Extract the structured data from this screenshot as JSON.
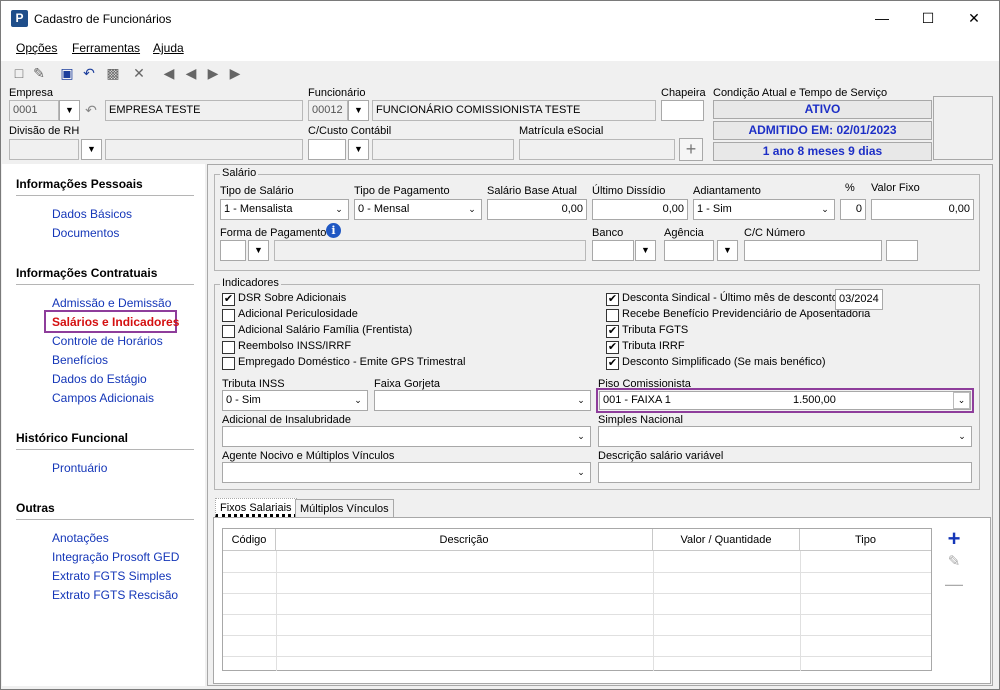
{
  "window": {
    "title": "Cadastro de Funcionários",
    "icon": "P"
  },
  "menu": {
    "opcoes": "Opções",
    "ferramentas": "Ferramentas",
    "ajuda": "Ajuda"
  },
  "header": {
    "empresa_label": "Empresa",
    "empresa_code": "0001",
    "empresa_name": "EMPRESA TESTE",
    "funcionario_label": "Funcionário",
    "funcionario_code": "00012",
    "funcionario_name": "FUNCIONÁRIO COMISSIONISTA TESTE",
    "chapeira_label": "Chapeira",
    "chapeira_value": "",
    "divisao_label": "Divisão de RH",
    "ccusto_label": "C/Custo Contábil",
    "matricula_label": "Matrícula eSocial",
    "condicao_label": "Condição Atual e Tempo de Serviço",
    "status": "ATIVO",
    "admitido": "ADMITIDO EM: 02/01/2023",
    "tempo": "1 ano 8 meses 9 dias"
  },
  "sidebar": {
    "s1": "Informações Pessoais",
    "s1_items": [
      "Dados Básicos",
      "Documentos"
    ],
    "s2": "Informações Contratuais",
    "s2_items": [
      "Admissão e Demissão",
      "Salários e Indicadores",
      "Controle de Horários",
      "Benefícios",
      "Dados do Estágio",
      "Campos Adicionais"
    ],
    "s3": "Histórico Funcional",
    "s3_items": [
      "Prontuário"
    ],
    "s4": "Outras",
    "s4_items": [
      "Anotações",
      "Integração Prosoft GED",
      "Extrato FGTS Simples",
      "Extrato FGTS Rescisão"
    ]
  },
  "salario": {
    "group": "Salário",
    "tipo_label": "Tipo de Salário",
    "tipo_value": "1 - Mensalista",
    "pagto_label": "Tipo de Pagamento",
    "pagto_value": "0 - Mensal",
    "base_label": "Salário Base Atual",
    "base_value": "0,00",
    "dissidio_label": "Último Dissídio",
    "dissidio_value": "0,00",
    "adiant_label": "Adiantamento",
    "adiant_value": "1 - Sim",
    "pct_label": "%",
    "pct_value": "0",
    "fixo_label": "Valor Fixo",
    "fixo_value": "0,00",
    "forma_label": "Forma de Pagamento",
    "banco_label": "Banco",
    "agencia_label": "Agência",
    "cc_label": "C/C Número"
  },
  "indicadores": {
    "group": "Indicadores",
    "left": [
      {
        "label": "DSR Sobre Adicionais",
        "checked": true
      },
      {
        "label": "Adicional Periculosidade",
        "checked": false
      },
      {
        "label": "Adicional Salário Família (Frentista)",
        "checked": false
      },
      {
        "label": "Reembolso INSS/IRRF",
        "checked": false
      },
      {
        "label": "Empregado Doméstico - Emite GPS Trimestral",
        "checked": false
      }
    ],
    "right": [
      {
        "label": "Desconta Sindical - Último mês de desconto",
        "checked": true
      },
      {
        "label": "Recebe Benefício Previdenciário de Aposentadoria",
        "checked": false
      },
      {
        "label": "Tributa FGTS",
        "checked": true
      },
      {
        "label": "Tributa IRRF",
        "checked": true
      },
      {
        "label": "Desconto Simplificado (Se mais benéfico)",
        "checked": true
      }
    ],
    "ultimo_mes": "03/2024",
    "tributa_inss_label": "Tributa INSS",
    "tributa_inss_value": "0 - Sim",
    "faixa_gorjeta_label": "Faixa Gorjeta",
    "piso_label": "Piso Comissionista",
    "piso_value": "001 - FAIXA 1",
    "piso_amount": "1.500,00",
    "insalub_label": "Adicional de Insalubridade",
    "simples_label": "Simples Nacional",
    "agente_label": "Agente Nocivo e  Múltiplos Vínculos",
    "descricao_label": "Descrição salário variável"
  },
  "tabs": {
    "fixos": "Fixos Salariais",
    "multiplos": "Múltiplos Vínculos"
  },
  "grid": {
    "columns": [
      "Código",
      "Descrição",
      "Valor / Quantidade",
      "Tipo"
    ]
  }
}
